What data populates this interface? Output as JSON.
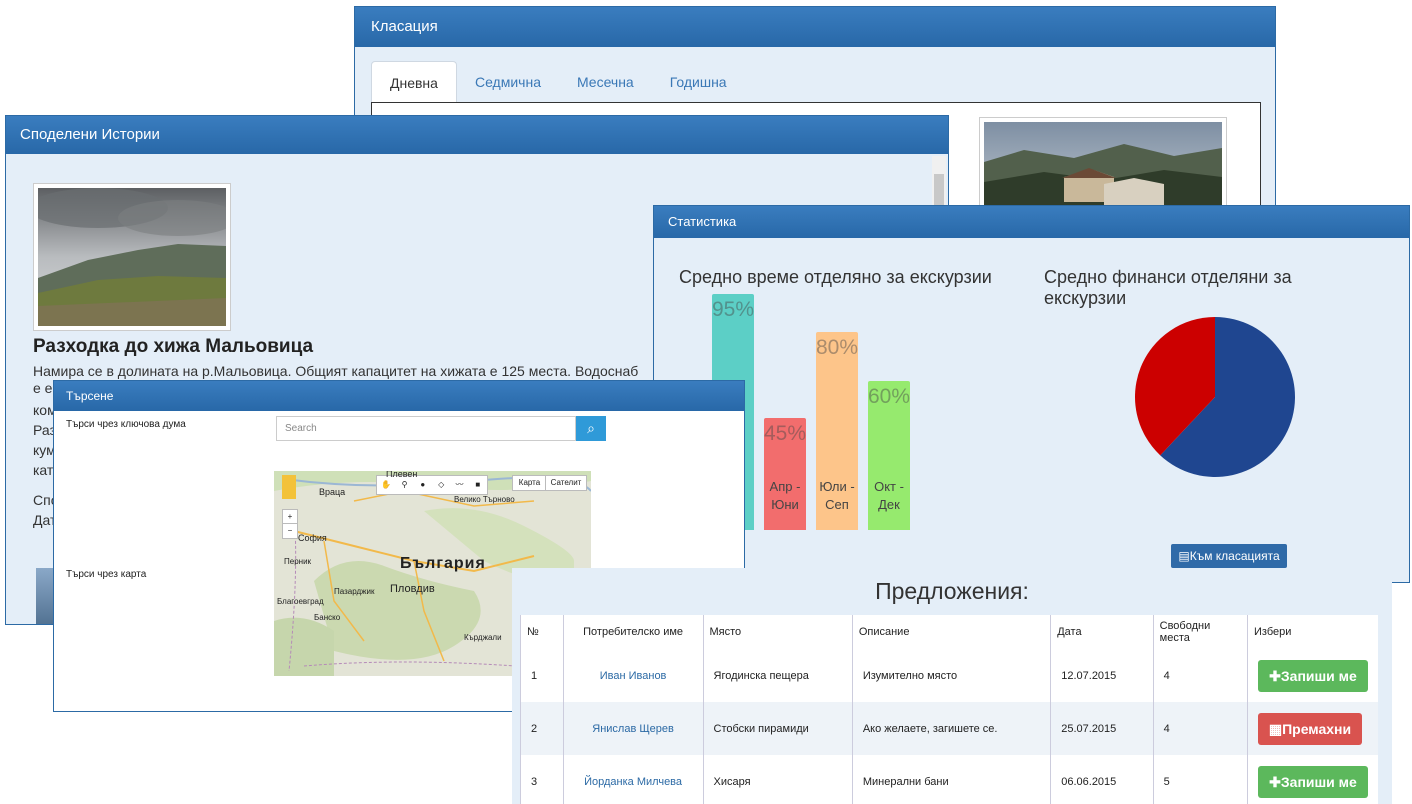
{
  "ranking": {
    "title": "Класация",
    "tabs": [
      {
        "label": "Дневна",
        "active": true
      },
      {
        "label": "Седмична",
        "active": false
      },
      {
        "label": "Месечна",
        "active": false
      },
      {
        "label": "Годишна",
        "active": false
      }
    ]
  },
  "stories": {
    "title": "Споделени Истории",
    "story_title": "Разходка до хижа Мальовица",
    "story_text": "Намира се в долината на р.Мальовица. Общият капацитет на хижата е 125 места. Водоснаб",
    "fragments": [
      "е е",
      "ком",
      "Раз",
      "кум",
      "кат",
      "Спо",
      "Дат"
    ]
  },
  "stats": {
    "title": "Статистика",
    "chart1_title": "Средно време отделяно за екскурзии",
    "chart2_title_line1": "Средно финанси отделяни за",
    "chart2_title_line2": "екскурзии",
    "button_label": "Към класацията"
  },
  "chart_data": [
    {
      "type": "bar",
      "title": "Средно време отделяно за екскурзии",
      "categories": [
        "",
        "Апр - Юни",
        "Юли - Сеп",
        "Окт - Дек"
      ],
      "values": [
        95,
        45,
        80,
        60
      ],
      "value_labels": [
        "95%",
        "45%",
        "80%",
        "60%"
      ],
      "colors": [
        "#5ccfc6",
        "#f26d6d",
        "#fdc58a",
        "#96ea6e"
      ],
      "ylim": [
        0,
        100
      ]
    },
    {
      "type": "pie",
      "title": "Средно финанси отделяни за екскурзии",
      "values": [
        62,
        38
      ],
      "colors": [
        "#1f4690",
        "#cc0000"
      ]
    }
  ],
  "search": {
    "title": "Търсене",
    "keyword_label": "Търси чрез ключова дума",
    "input_placeholder": "Search",
    "map_label": "Търси чрез карта",
    "map_type_map": "Карта",
    "map_type_sat": "Сателит",
    "map_country": "България",
    "cities": [
      "Плевен",
      "Враца",
      "Велико Търново",
      "София",
      "Перник",
      "Пловдив",
      "Пазарджик",
      "Благоевград",
      "Банско",
      "Кърджали"
    ]
  },
  "offers": {
    "title": "Предложения:",
    "columns": [
      "№",
      "Потребителско име",
      "Място",
      "Описание",
      "Дата",
      "Свободни места",
      "Избери"
    ],
    "rows": [
      {
        "no": "1",
        "user": "Иван Иванов",
        "place": "Ягодинска пещера",
        "desc": "Изумително място",
        "date": "12.07.2015",
        "seats": "4",
        "action": "Запиши ме",
        "action_type": "add"
      },
      {
        "no": "2",
        "user": "Янислав Щерев",
        "place": "Стобски пирамиди",
        "desc": "Ако желаете, загишете се.",
        "date": "25.07.2015",
        "seats": "4",
        "action": "Премахни",
        "action_type": "remove"
      },
      {
        "no": "3",
        "user": "Йорданка Милчева",
        "place": "Хисаря",
        "desc": "Минерални бани",
        "date": "06.06.2015",
        "seats": "5",
        "action": "Запиши ме",
        "action_type": "add"
      }
    ]
  }
}
